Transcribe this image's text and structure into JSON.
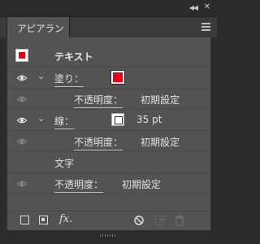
{
  "window": {
    "collapse_icon": "double-chevron-left-icon",
    "close_icon": "close-icon"
  },
  "panel": {
    "tab_title": "アピアランス",
    "menu_icon": "hamburger-menu-icon"
  },
  "appearance": {
    "object_type": "テキスト",
    "fill": {
      "label": "塗り：",
      "color": "#e3001b"
    },
    "fill_opacity": {
      "label": "不透明度：",
      "value": "初期設定"
    },
    "stroke": {
      "label": "線：",
      "color": "#ffffff",
      "value": "35 pt"
    },
    "stroke_opacity": {
      "label": "不透明度：",
      "value": "初期設定"
    },
    "characters": {
      "label": "文字"
    },
    "opacity": {
      "label": "不透明度：",
      "value": "初期設定"
    }
  },
  "footer": {
    "fx_label": "fx.",
    "icons": [
      "add-new-stroke-icon",
      "add-new-fill-icon",
      "add-effect-icon",
      "clear-appearance-icon",
      "duplicate-item-icon",
      "delete-item-icon"
    ]
  },
  "colors": {
    "panel_bg": "#535353",
    "frame_bg": "#2b2b2b",
    "fill_red": "#e3001b"
  }
}
